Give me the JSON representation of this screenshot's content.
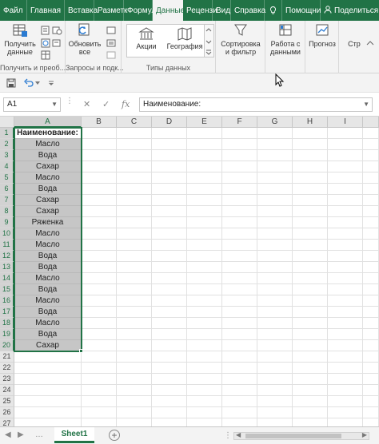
{
  "ribbon_tabs": [
    {
      "label": "Файл"
    },
    {
      "label": "Главная"
    },
    {
      "label": "Вставка"
    },
    {
      "label": "Разметк"
    },
    {
      "label": "Формул"
    },
    {
      "label": "Данные",
      "active": true
    },
    {
      "label": "Рецензи"
    },
    {
      "label": "Вид"
    },
    {
      "label": "Справка"
    },
    {
      "label": "Помощни"
    },
    {
      "label": "Поделиться"
    }
  ],
  "ribbon": {
    "get_data": "Получить данные",
    "refresh_all": "Обновить все",
    "stocks": "Акции",
    "geography": "География",
    "sort_filter": "Сортировка и фильтр",
    "data_tools": "Работа с данными",
    "forecast": "Прогноз",
    "structure": "Стр",
    "group_get": "Получить и преоб...",
    "group_queries": "Запросы и подк...",
    "group_types": "Типы данных"
  },
  "formula_bar": {
    "name_box": "A1",
    "formula": "Наименование:",
    "cancel_icon": "✕",
    "enter_icon": "✓",
    "fx_label": "fx"
  },
  "grid": {
    "columns": [
      "A",
      "B",
      "C",
      "D",
      "E",
      "F",
      "G",
      "H",
      "I"
    ],
    "row_numbers": [
      "1",
      "2",
      "3",
      "4",
      "5",
      "6",
      "7",
      "8",
      "9",
      "10",
      "11",
      "12",
      "13",
      "14",
      "15",
      "16",
      "17",
      "18",
      "19",
      "20",
      "21",
      "22",
      "23",
      "24",
      "25",
      "26",
      "27"
    ],
    "column_a": [
      "Наименование:",
      "Масло",
      "Вода",
      "Сахар",
      "Масло",
      "Вода",
      "Сахар",
      "Сахар",
      "Ряженка",
      "Масло",
      "Масло",
      "Вода",
      "Вода",
      "Масло",
      "Вода",
      "Масло",
      "Вода",
      "Масло",
      "Вода",
      "Сахар"
    ]
  },
  "sheets": [
    {
      "label": "Sheet1",
      "active": true
    }
  ],
  "colors": {
    "accent": "#217346",
    "selection": "#c6c6c6"
  }
}
